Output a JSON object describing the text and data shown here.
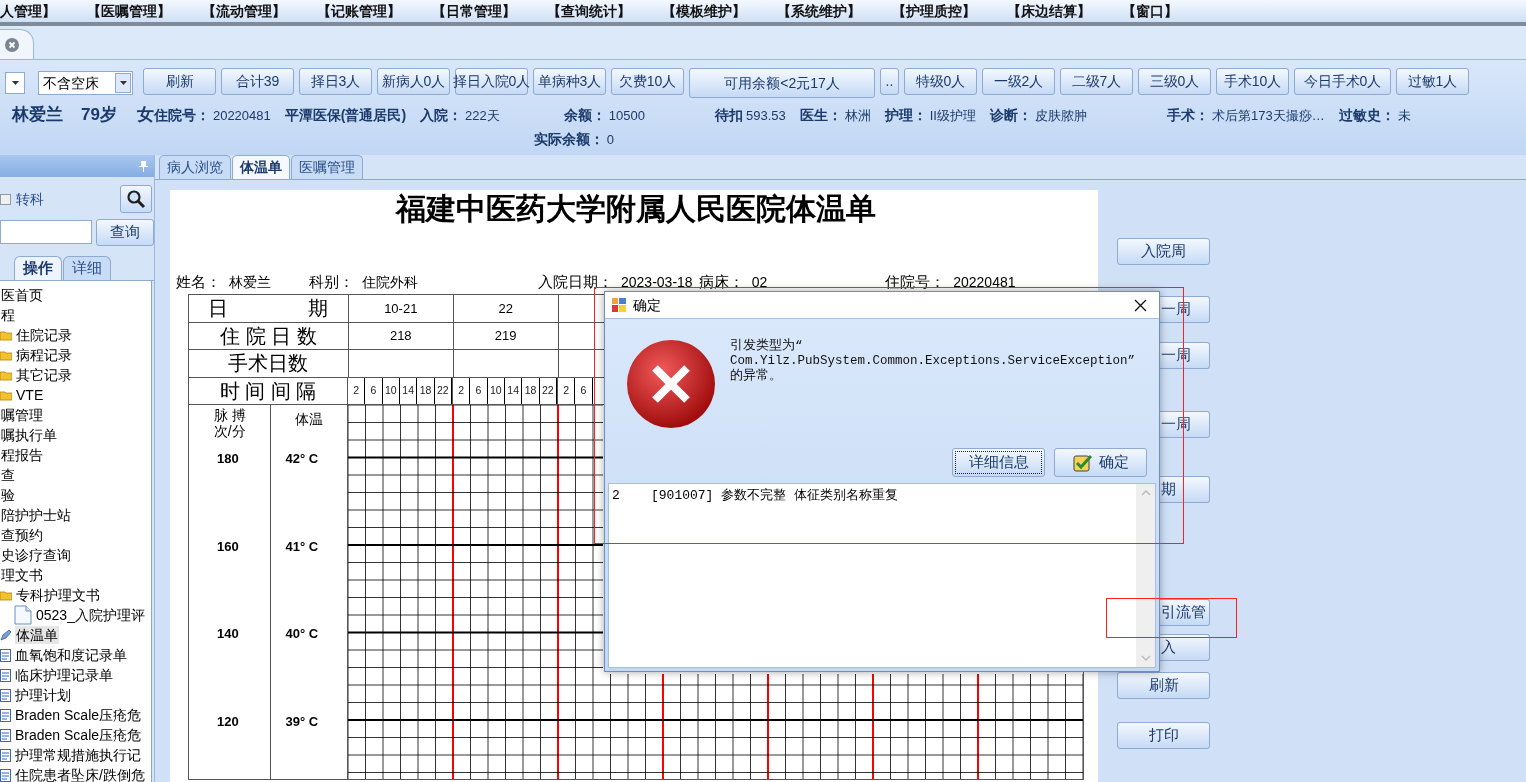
{
  "menu": [
    "人管理】",
    "【医嘱管理】",
    "【流动管理】",
    "【记账管理】",
    "【日常管理】",
    "【查询统计】",
    "【模板维护】",
    "【系统维护】",
    "【护理质控】",
    "【床边结算】",
    "【窗口】"
  ],
  "toolbar": {
    "bed_filter": {
      "value": "不含空床"
    },
    "buttons": [
      {
        "label": "刷新",
        "kind": "normal"
      },
      {
        "label": "合计39",
        "kind": "normal"
      },
      {
        "label": "择日3人",
        "kind": "normal"
      },
      {
        "label": "新病人0人",
        "kind": "normal"
      },
      {
        "label": "择日入院0人",
        "kind": "normal"
      },
      {
        "label": "单病种3人",
        "kind": "normal"
      },
      {
        "label": "欠费10人",
        "kind": "normal"
      },
      {
        "label": "可用余额<2元17人",
        "kind": "wide"
      },
      {
        "label": "..",
        "kind": "small"
      },
      {
        "label": "特级0人",
        "kind": "normal"
      },
      {
        "label": "一级2人",
        "kind": "normal"
      },
      {
        "label": "二级7人",
        "kind": "normal"
      },
      {
        "label": "三级0人",
        "kind": "normal"
      },
      {
        "label": "手术10人",
        "kind": "normal"
      },
      {
        "label": "今日手术0人",
        "kind": "wide2"
      },
      {
        "label": "过敏1人",
        "kind": "normal"
      }
    ]
  },
  "patient": {
    "name": "林爱兰",
    "age": "79岁",
    "sex": "女",
    "fields": [
      {
        "label": "住院号：",
        "value": "20220481"
      },
      {
        "label": "平潭医保(普通居民)"
      },
      {
        "label": "入院：",
        "value": "222天"
      },
      {
        "label": "余额：",
        "value": "10500",
        "sub_label": "实际余额：",
        "sub_value": "0"
      },
      {
        "label": "待扣",
        "value": "593.53"
      },
      {
        "label": "医生：",
        "value": "林洲"
      },
      {
        "label": "护理：",
        "value": "II级护理"
      },
      {
        "label": "诊断：",
        "value": "皮肤脓肿"
      },
      {
        "label": "手术：",
        "value": "术后第173天撮痧…"
      },
      {
        "label": "过敏史：",
        "value": "未"
      }
    ]
  },
  "left_panel": {
    "transfer": {
      "label": "转科",
      "checked": false
    },
    "query_button": "查询",
    "tabs": [
      {
        "label": "操作",
        "selected": true
      },
      {
        "label": "详细",
        "selected": false
      }
    ],
    "tree": [
      {
        "label": "医首页",
        "kind": "plain",
        "selected": false
      },
      {
        "label": "程",
        "kind": "plain",
        "selected": false,
        "children": [
          {
            "label": "住院记录",
            "kind": "folder",
            "selected": false
          },
          {
            "label": "病程记录",
            "kind": "folder",
            "selected": false
          },
          {
            "label": "其它记录",
            "kind": "folder",
            "selected": false
          },
          {
            "label": "VTE",
            "kind": "folder",
            "selected": false
          }
        ]
      },
      {
        "label": "嘱管理",
        "kind": "plain",
        "selected": false
      },
      {
        "label": "嘱执行单",
        "kind": "plain",
        "selected": false
      },
      {
        "label": "程报告",
        "kind": "plain",
        "selected": false
      },
      {
        "label": "查",
        "kind": "plain",
        "selected": false
      },
      {
        "label": "验",
        "kind": "plain",
        "selected": false
      },
      {
        "label": "陪护护士站",
        "kind": "plain",
        "selected": false
      },
      {
        "label": "查预约",
        "kind": "plain",
        "selected": false
      },
      {
        "label": "史诊疗查询",
        "kind": "plain",
        "selected": false
      },
      {
        "label": "理文书",
        "kind": "plain",
        "selected": false,
        "children": [
          {
            "label": "专科护理文书",
            "kind": "folder",
            "selected": false,
            "children": [
              {
                "label": "0523_入院护理评",
                "kind": "page",
                "selected": false
              }
            ]
          },
          {
            "label": "体温单",
            "kind": "pen",
            "selected": true
          },
          {
            "label": "血氧饱和度记录单",
            "kind": "doc",
            "selected": false
          },
          {
            "label": "临床护理记录单",
            "kind": "doc",
            "selected": false
          },
          {
            "label": "护理计划",
            "kind": "doc",
            "selected": false
          },
          {
            "label": "Braden Scale压疮危",
            "kind": "doc",
            "selected": false
          },
          {
            "label": "Braden Scale压疮危",
            "kind": "doc",
            "selected": false
          },
          {
            "label": "护理常规措施执行记",
            "kind": "doc",
            "selected": false
          },
          {
            "label": "住院患者坠床/跌倒危",
            "kind": "doc",
            "selected": false
          }
        ]
      }
    ]
  },
  "main_tabs": [
    {
      "label": "病人浏览",
      "selected": false
    },
    {
      "label": "体温单",
      "selected": true
    },
    {
      "label": "医嘱管理",
      "selected": false
    }
  ],
  "sheet": {
    "title": "福建中医药大学附属人民医院体温单",
    "header": [
      {
        "label": "姓名：",
        "value": "林爱兰"
      },
      {
        "label": "科别：",
        "value": "住院外科"
      },
      {
        "label": "入院日期：",
        "value": "2023-03-18"
      },
      {
        "label": "病床：",
        "value": "02"
      },
      {
        "label": "住院号：",
        "value": "20220481"
      }
    ],
    "row_labels": [
      "日　　　　期",
      "住 院 日 数",
      "手术日数",
      "时 间 间 隔"
    ],
    "days": [
      {
        "date": "10-21",
        "stay": "218",
        "times": [
          "2",
          "6",
          "10",
          "14",
          "18",
          "22"
        ]
      },
      {
        "date": "22",
        "stay": "219",
        "times": [
          "2",
          "6",
          "10",
          "14",
          "18",
          "22"
        ]
      },
      {
        "times": [
          "2",
          "6"
        ]
      }
    ],
    "pulse_label": [
      "脉 搏",
      "次/分"
    ],
    "temp_label": "体温",
    "scale": [
      {
        "pulse": "180",
        "temp": "42° C"
      },
      {
        "pulse": "160",
        "temp": "41° C"
      },
      {
        "pulse": "140",
        "temp": "40° C"
      },
      {
        "pulse": "120",
        "temp": "39° C"
      }
    ]
  },
  "right_buttons": [
    {
      "label": "入院周",
      "covered": false
    },
    {
      "label": "一周",
      "covered": true
    },
    {
      "label": "一周",
      "covered": true
    },
    {
      "label": "一周",
      "covered": true
    },
    {
      "label": "期",
      "covered": true
    },
    {
      "label": "引流管",
      "covered": true
    },
    {
      "label": "入",
      "covered": true
    },
    {
      "label": "刷新",
      "covered": false
    },
    {
      "label": "打印",
      "covered": false
    }
  ],
  "dialog": {
    "title": "确定",
    "message": "引发类型为“\nCom.Yilz.PubSystem.Common.Exceptions.ServiceException”\n的异常。",
    "buttons": [
      {
        "label": "详细信息",
        "focused": true,
        "kind": "plain"
      },
      {
        "label": "确定",
        "focused": false,
        "kind": "ok"
      }
    ],
    "detail": "2    [901007] 参数不完整 体征类别名称重复"
  }
}
